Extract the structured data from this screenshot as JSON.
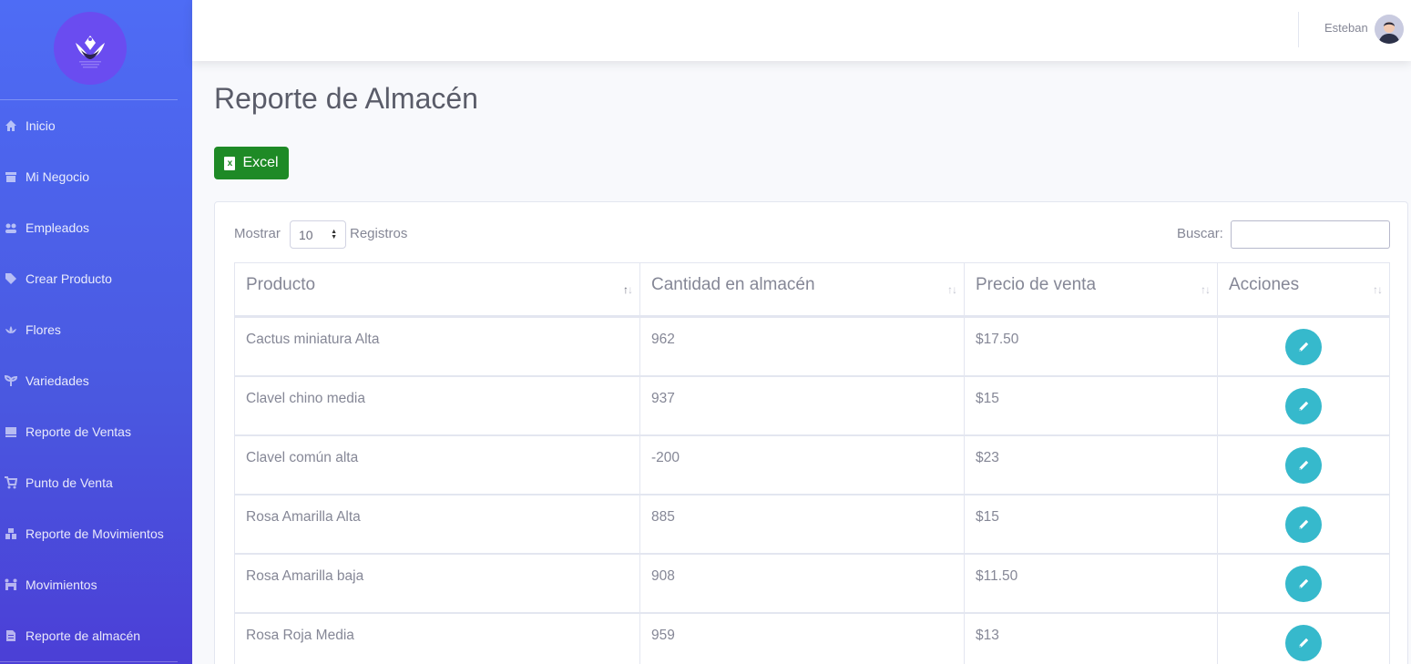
{
  "sidebar": {
    "items": [
      {
        "label": "Inicio",
        "icon": "home-icon"
      },
      {
        "label": "Mi Negocio",
        "icon": "store-icon"
      },
      {
        "label": "Empleados",
        "icon": "users-icon"
      },
      {
        "label": "Crear Producto",
        "icon": "tag-icon"
      },
      {
        "label": "Flores",
        "icon": "lotus-icon"
      },
      {
        "label": "Variedades",
        "icon": "seedling-icon"
      },
      {
        "label": "Reporte de Ventas",
        "icon": "pallet-icon"
      },
      {
        "label": "Punto de Venta",
        "icon": "cart-icon"
      },
      {
        "label": "Reporte de Movimientos",
        "icon": "boxes-icon"
      },
      {
        "label": "Movimientos",
        "icon": "people-carry-icon"
      },
      {
        "label": "Reporte de almacén",
        "icon": "file-icon"
      }
    ]
  },
  "topbar": {
    "user_name": "Esteban"
  },
  "page": {
    "title": "Reporte de Almacén",
    "excel_label": "Excel"
  },
  "table_controls": {
    "show_label": "Mostrar",
    "length_value": "10",
    "records_label": "Registros",
    "search_label": "Buscar:",
    "search_value": ""
  },
  "table": {
    "headers": [
      "Producto",
      "Cantidad en almacén",
      "Precio de venta",
      "Acciones"
    ],
    "rows": [
      {
        "producto": "Cactus miniatura Alta",
        "cantidad": "962",
        "precio": "$17.50"
      },
      {
        "producto": "Clavel chino media",
        "cantidad": "937",
        "precio": "$15"
      },
      {
        "producto": "Clavel común alta",
        "cantidad": "-200",
        "precio": "$23"
      },
      {
        "producto": "Rosa Amarilla Alta",
        "cantidad": "885",
        "precio": "$15"
      },
      {
        "producto": "Rosa Amarilla baja",
        "cantidad": "908",
        "precio": "$11.50"
      },
      {
        "producto": "Rosa Roja Media",
        "cantidad": "959",
        "precio": "$13"
      }
    ]
  },
  "colors": {
    "sidebar": "#4e6cf5",
    "excel_button": "#1e8a26",
    "edit_button": "#36b9cc"
  }
}
